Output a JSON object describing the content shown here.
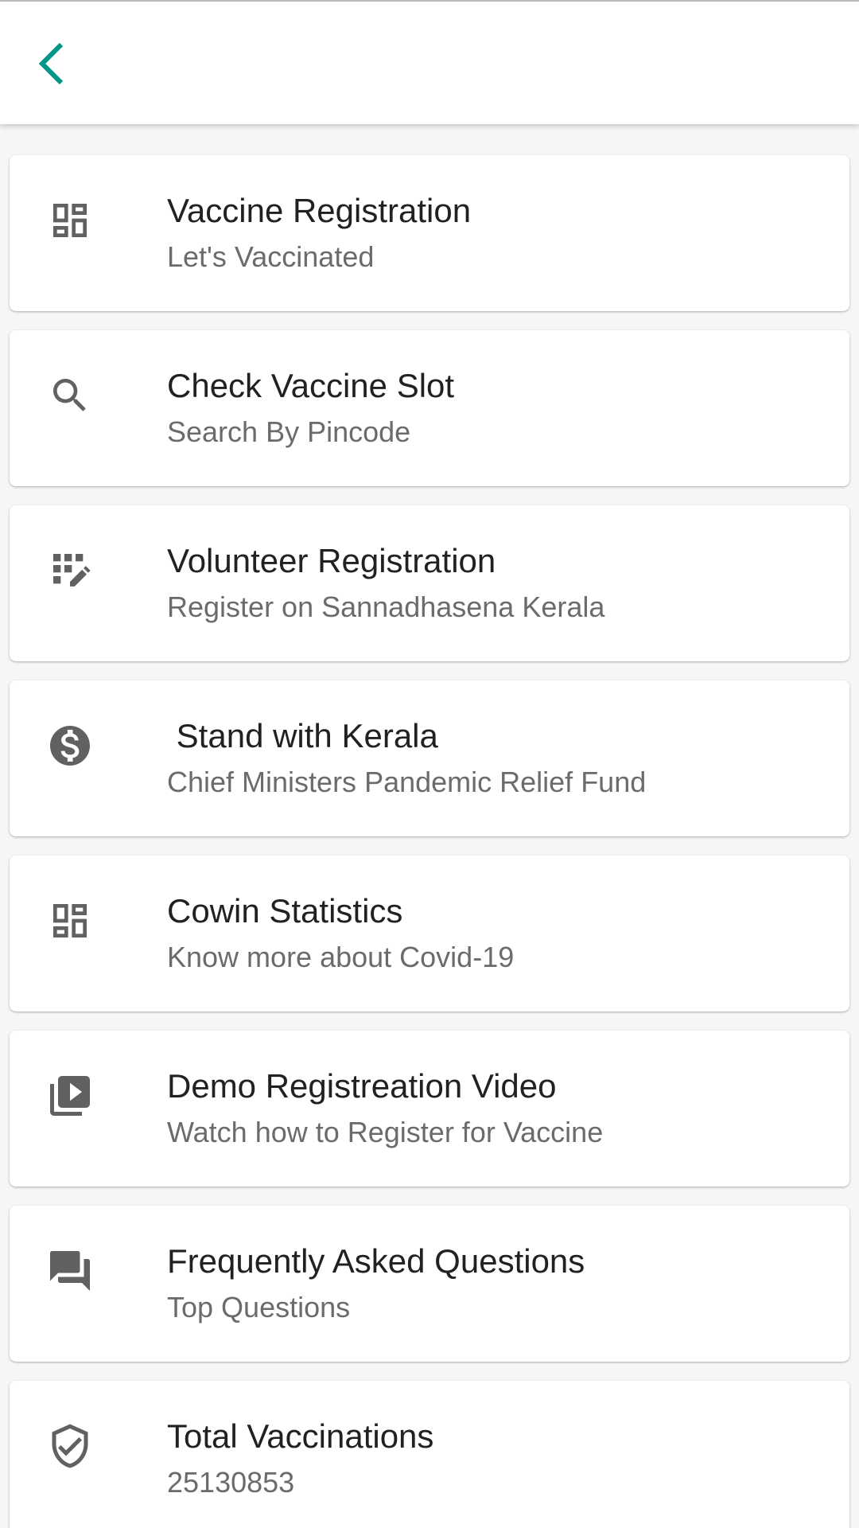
{
  "colors": {
    "accent": "#009688",
    "icon": "#616161",
    "title": "#212121",
    "subtitle": "#6b6b6b",
    "background": "#f6f6f6"
  },
  "appbar": {
    "back_icon": "chevron-left-icon"
  },
  "menu": {
    "items": [
      {
        "icon": "dashboard-icon",
        "title": "Vaccine Registration",
        "subtitle": "Let's Vaccinated"
      },
      {
        "icon": "search-icon",
        "title": "Check Vaccine Slot",
        "subtitle": "Search By Pincode"
      },
      {
        "icon": "grid-edit-icon",
        "title": "Volunteer Registration",
        "subtitle": "Register on Sannadhasena Kerala"
      },
      {
        "icon": "dollar-circle-icon",
        "title": " Stand with Kerala",
        "subtitle": "Chief Ministers Pandemic Relief Fund"
      },
      {
        "icon": "dashboard-icon",
        "title": "Cowin Statistics",
        "subtitle": "Know more about Covid-19"
      },
      {
        "icon": "video-library-icon",
        "title": "Demo Registreation Video",
        "subtitle": "Watch how to Register for Vaccine"
      },
      {
        "icon": "forum-icon",
        "title": "Frequently Asked Questions",
        "subtitle": "Top Questions"
      },
      {
        "icon": "verified-shield-icon",
        "title": "Total Vaccinations",
        "subtitle": "25130853"
      }
    ]
  }
}
